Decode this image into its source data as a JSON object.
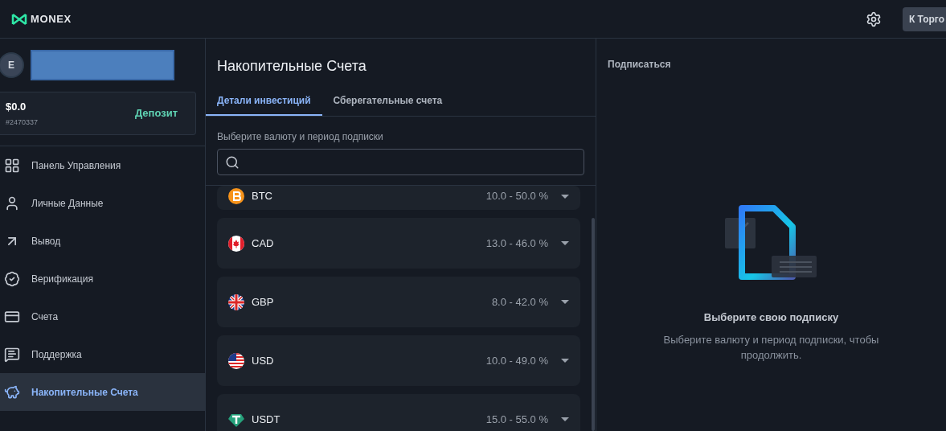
{
  "header": {
    "logo": "MONEX",
    "trade_button": "К Торго"
  },
  "sidebar": {
    "avatar": "E",
    "balance": "$0.0",
    "account": "#2470337",
    "deposit": "Депозит",
    "items": [
      {
        "label": "Панель Управления",
        "kind": "dashboard",
        "selected": false
      },
      {
        "label": "Личные Данные",
        "kind": "person",
        "selected": false
      },
      {
        "label": "Вывод",
        "kind": "withdraw",
        "selected": false
      },
      {
        "label": "Верификация",
        "kind": "verify",
        "selected": false
      },
      {
        "label": "Счета",
        "kind": "card",
        "selected": false
      },
      {
        "label": "Поддержка",
        "kind": "chat",
        "selected": false
      },
      {
        "label": "Накопительные Счета",
        "kind": "piggy",
        "selected": true
      }
    ]
  },
  "main": {
    "title": "Накопительные Счета",
    "tabs": [
      {
        "label": "Детали инвестиций",
        "selected": true
      },
      {
        "label": "Сберегательные счета",
        "selected": false
      }
    ],
    "field_label": "Выберите валюту и период подписки",
    "currencies": [
      {
        "code": "BTC",
        "range": "10.0 - 50.0 %",
        "kind": "btc"
      },
      {
        "code": "CAD",
        "range": "13.0 - 46.0 %",
        "kind": "cad"
      },
      {
        "code": "GBP",
        "range": "8.0 - 42.0 %",
        "kind": "gbp"
      },
      {
        "code": "USD",
        "range": "10.0 - 49.0 %",
        "kind": "usd"
      },
      {
        "code": "USDT",
        "range": "15.0 - 55.0 %",
        "kind": "usdt"
      }
    ]
  },
  "subscribe": {
    "title": "Подписаться",
    "empty_title": "Выберите свою подписку",
    "empty_text": "Выберите валюту и период подписки, чтобы продолжить."
  }
}
